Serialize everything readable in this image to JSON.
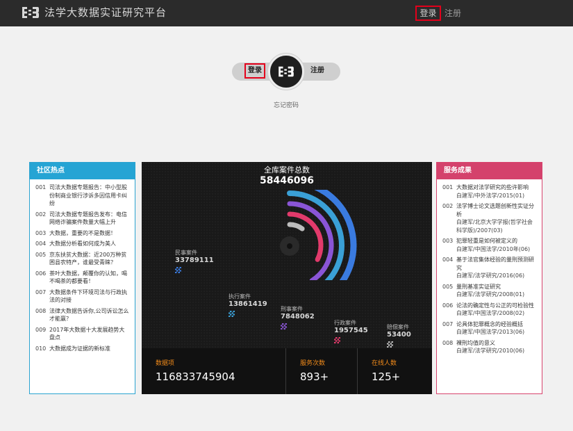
{
  "header": {
    "title": "法学大数据实证研究平台",
    "login_label": "登录",
    "register_label": "注册"
  },
  "login_box": {
    "login_label": "登录",
    "register_label": "注册",
    "forgot_label": "忘记密码"
  },
  "hot_topics": {
    "title": "社区热点",
    "items": [
      {
        "num": "001",
        "text": "司法大数据专题报告：中小型股份制商业银行涉诉多因信用卡纠纷"
      },
      {
        "num": "002",
        "text": "司法大数据专题报告发布：电信网络诈骗案件数量大幅上升"
      },
      {
        "num": "003",
        "text": "大数据，重要的不是数据！"
      },
      {
        "num": "004",
        "text": "大数据分析看如何成为美人"
      },
      {
        "num": "005",
        "text": "京东扶贫大数据：近200万种贫困县农特产，谁最受青睐？"
      },
      {
        "num": "006",
        "text": "茶叶大数据，颠覆你的认知，喝不喝茶的都要看！"
      },
      {
        "num": "007",
        "text": "大数据条件下环境司法与行政执法的对接"
      },
      {
        "num": "008",
        "text": "法律大数据告诉你,公司诉讼怎么才能赢？"
      },
      {
        "num": "009",
        "text": "2017年大数据十大发展趋势大盘点"
      },
      {
        "num": "010",
        "text": "大数据成为证据的新标准"
      }
    ]
  },
  "service_results": {
    "title": "服务成果",
    "items": [
      {
        "num": "001",
        "text": "大数据对法学研究的些许影响",
        "sub": "白建军/中外法学/2015(01)"
      },
      {
        "num": "002",
        "text": "法学博士论文选题创新性实证分析",
        "sub": "白建军/北京大学学报(哲学社会科学版)/2007(03)"
      },
      {
        "num": "003",
        "text": "犯罪轻重是如何被定义的",
        "sub": "白建军/中国法学/2010年(06)"
      },
      {
        "num": "004",
        "text": "基于法官集体经验的量刑预测研究",
        "sub": "白建军/法学研究/2016(06)"
      },
      {
        "num": "005",
        "text": "量刑基准实证研究",
        "sub": "白建军/法学研究/2008(01)"
      },
      {
        "num": "006",
        "text": "论法的确定性与公正的可检验性",
        "sub": "白建军/中国法学/2008(02)"
      },
      {
        "num": "007",
        "text": "论具体犯罪概念的经验概括",
        "sub": "白建军/中国法学/2013(06)"
      },
      {
        "num": "008",
        "text": "裸刑均值的意义",
        "sub": "白建军/法学研究/2010(06)"
      }
    ]
  },
  "stats": {
    "title": "全库案件总数",
    "total": "58446096",
    "categories": [
      {
        "label": "民事案件",
        "value": "33789111",
        "color": "#3a7be0"
      },
      {
        "label": "执行案件",
        "value": "13861419",
        "color": "#3aa0d6"
      },
      {
        "label": "刑事案件",
        "value": "7848062",
        "color": "#8a55d6"
      },
      {
        "label": "行政案件",
        "value": "1957545",
        "color": "#e23a6b"
      },
      {
        "label": "赔偿案件",
        "value": "53400",
        "color": "#bdbdbd"
      }
    ],
    "summary": [
      {
        "label": "数据项",
        "value": "116833745904"
      },
      {
        "label": "服务次数",
        "value": "893+"
      },
      {
        "label": "在线人数",
        "value": "125+"
      }
    ]
  }
}
